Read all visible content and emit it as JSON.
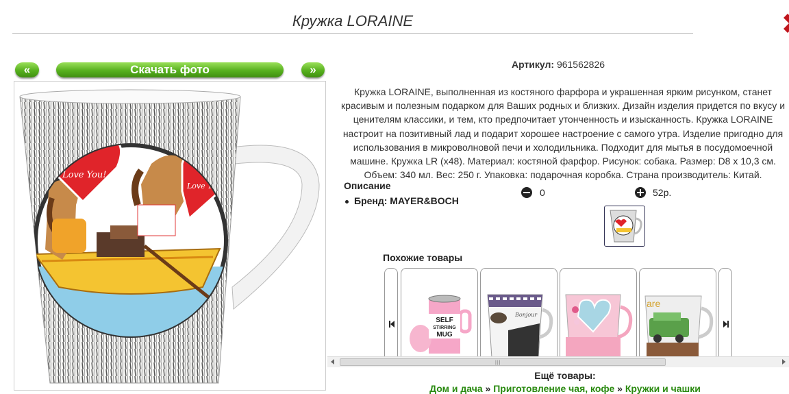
{
  "product": {
    "title": "Кружка LORAINE",
    "article_label": "Артикул:",
    "article_value": "961562826",
    "description": "Кружка LORAINE, выполненная из костяного фарфора и украшенная ярким рисунком, станет красивым и полезным подарком для Ваших родных и близких. Дизайн изделия придется по вкусу и ценителям классики, и тем, кто предпочитает утонченность и изысканность. Кружка LORAINE настроит на позитивный лад и подарит хорошее настроение с самого утра. Изделие пригодно для использования в микроволновой печи и холодильника. Подходит для мытья в посудомоечной машине. Кружка LR (x48). Материал: костяной фарфор. Рисунок: собака. Размер: D8 х 10,3 см. Объем: 340 мл. Вес: 250 г. Упаковка: подарочная коробка. Страна производитель: Китай.",
    "specs_title": "Описание",
    "brand": "Бренд: MAYER&BOCH",
    "quantity": "0",
    "price": "52р."
  },
  "photo_nav": {
    "prev_label": "«",
    "download_label": "Скачать фото",
    "next_label": "»"
  },
  "mug_art": {
    "heart_text_1": "Love You!",
    "heart_text_2": "Love You!"
  },
  "similar": {
    "title": "Похожие товары",
    "items": [
      {
        "art_text_1": "SELF",
        "art_text_2": "STIRRING",
        "art_text_3": "MUG"
      },
      {
        "art_text_1": "Bonjour"
      },
      {
        "art_text_1": ""
      },
      {
        "art_text_1": "are"
      }
    ]
  },
  "more": {
    "title": "Ещё товары:",
    "breadcrumbs": [
      "Дом и дача",
      "Приготовление чая, кофе",
      "Кружки и чашки"
    ],
    "separator": "»"
  },
  "colors": {
    "accent_green": "#57b01e",
    "link_green": "#2a8a10",
    "close_red": "#c0141b"
  }
}
